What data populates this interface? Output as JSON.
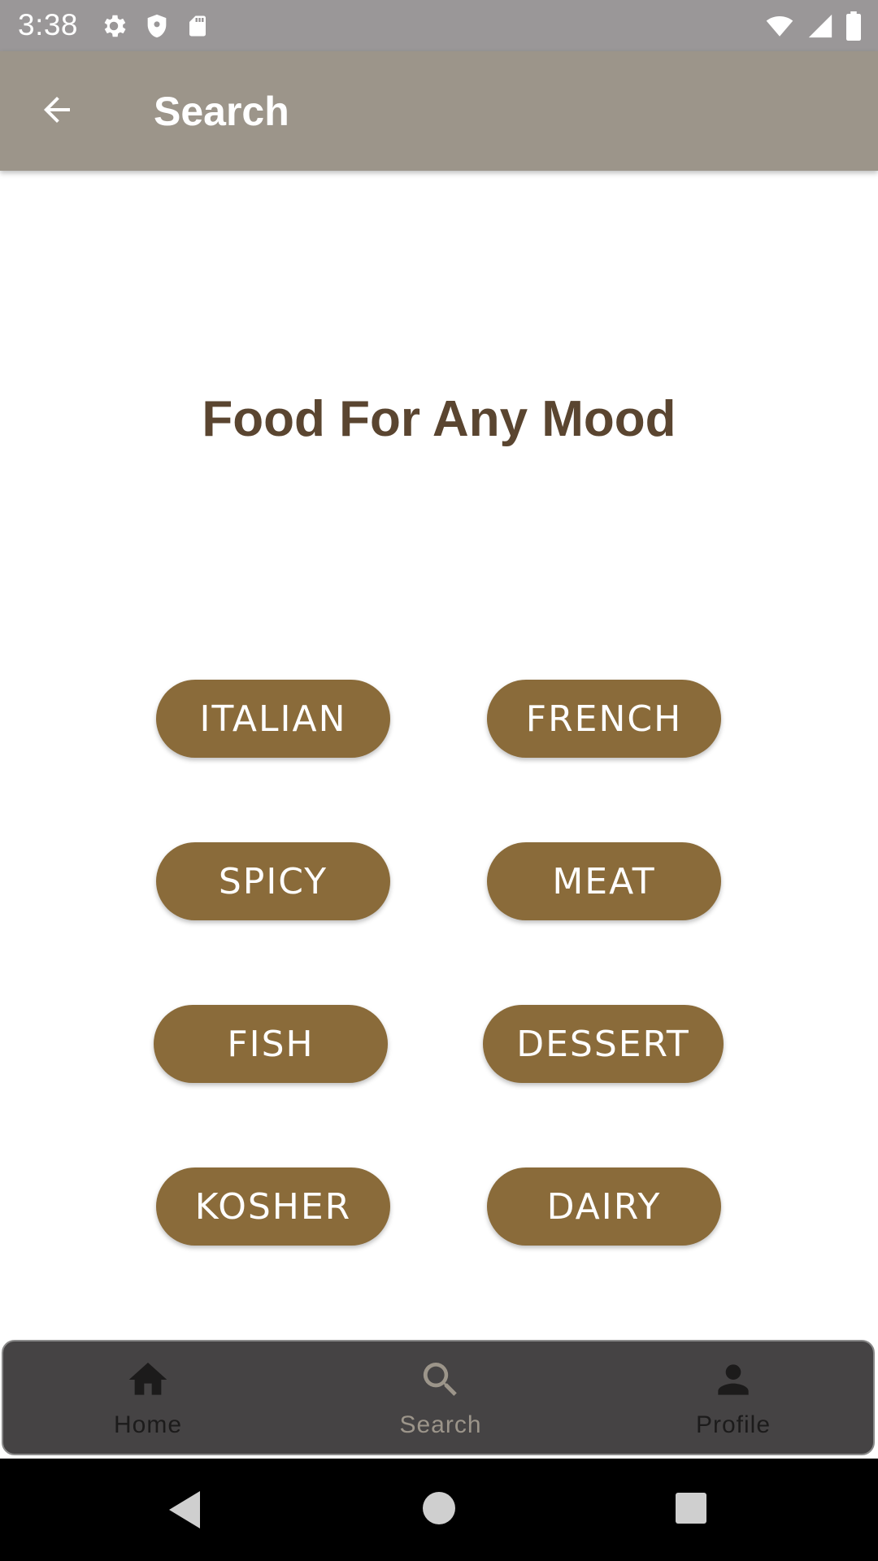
{
  "status_bar": {
    "time": "3:38",
    "icons_left": [
      "settings-icon",
      "shield-icon",
      "sd-card-icon"
    ],
    "icons_right": [
      "wifi-icon",
      "cellular-icon",
      "battery-icon"
    ]
  },
  "app_bar": {
    "title": "Search",
    "back_icon": "arrow-back-icon",
    "background": "#9c958a"
  },
  "main": {
    "headline": "Food For Any Mood",
    "headline_color": "#5a4530",
    "chip_color": "#8a6b3a",
    "chips": [
      {
        "label": "ITALIAN"
      },
      {
        "label": "FRENCH"
      },
      {
        "label": "SPICY"
      },
      {
        "label": "MEAT"
      },
      {
        "label": "FISH"
      },
      {
        "label": "DESSERT"
      },
      {
        "label": "KOSHER"
      },
      {
        "label": "DAIRY"
      }
    ]
  },
  "bottom_nav": {
    "items": [
      {
        "label": "Home",
        "icon": "home-icon"
      },
      {
        "label": "Search",
        "icon": "search-icon",
        "selected": true
      },
      {
        "label": "Profile",
        "icon": "person-icon"
      }
    ]
  },
  "system_nav": {
    "buttons": [
      "back-triangle-icon",
      "home-circle-icon",
      "recents-square-icon"
    ]
  }
}
